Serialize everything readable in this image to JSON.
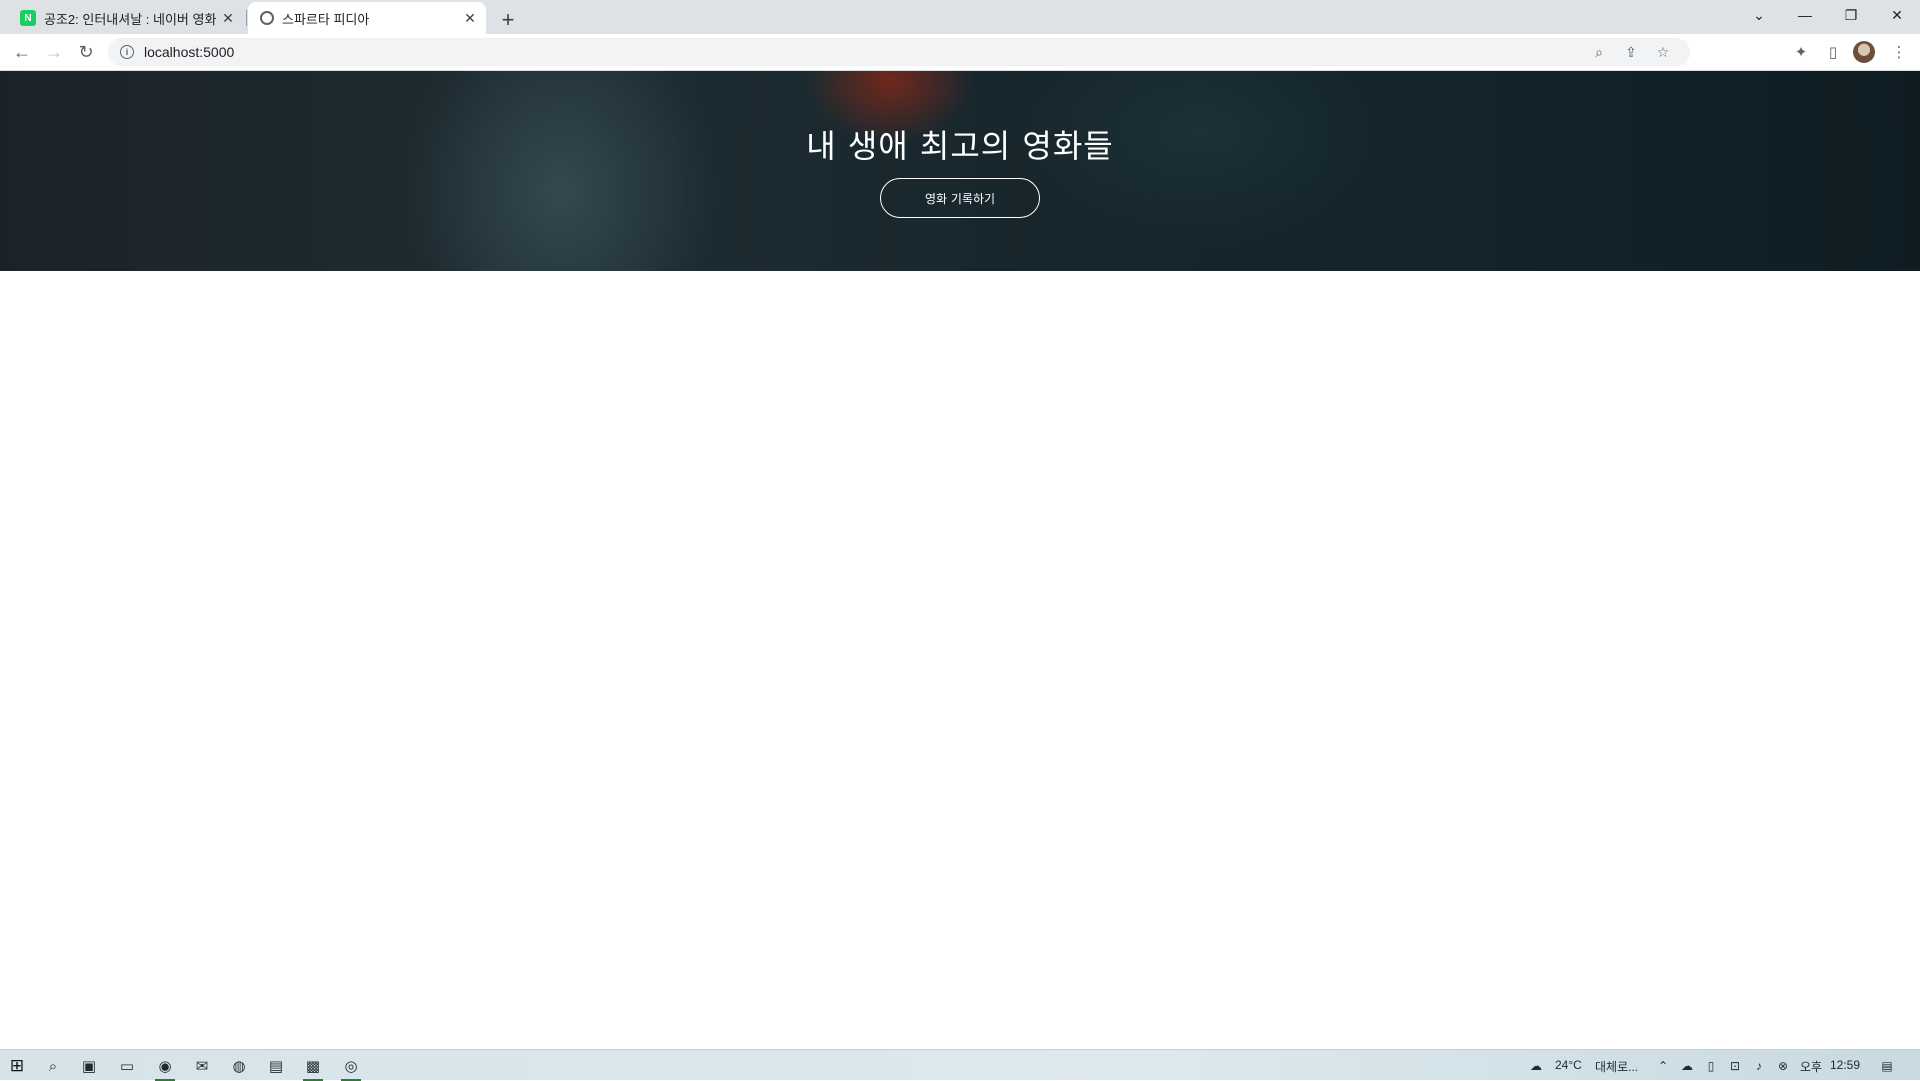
{
  "browser": {
    "tabs": [
      {
        "title": "공조2: 인터내셔날 : 네이버 영화",
        "active": false,
        "favicon": "naver-icon"
      },
      {
        "title": "스파르타 피디아",
        "active": true,
        "favicon": "globe-icon"
      }
    ],
    "url": "localhost:5000"
  },
  "hero": {
    "title": "내 생애 최고의 영화들",
    "button_label": "영화 기록하기"
  },
  "taskbar": {
    "weather_temp": "24°C",
    "weather_text": "대체로...",
    "time_ampm": "오후",
    "time": "12:59"
  },
  "colors": {
    "hero_background": "#17262c",
    "page_background": "#ffffff",
    "tab_strip": "#dee1e6"
  }
}
